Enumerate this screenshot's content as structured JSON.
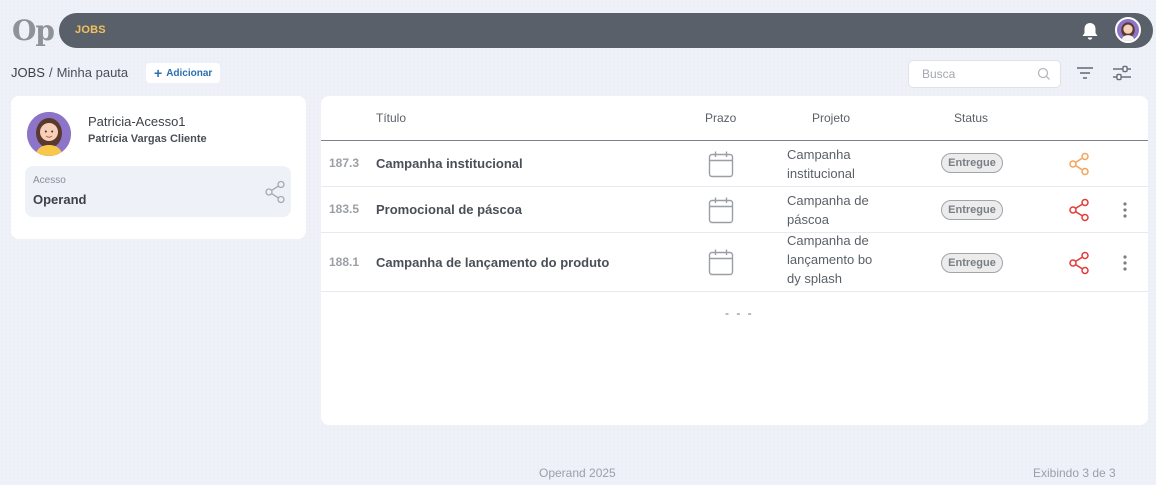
{
  "app": {
    "logo": "Op",
    "section": "JOBS"
  },
  "breadcrumb": {
    "root": "JOBS",
    "separator": "/",
    "current": "Minha pauta"
  },
  "toolbar": {
    "add_label": "Adicionar"
  },
  "search": {
    "placeholder": "Busca",
    "value": ""
  },
  "profile": {
    "name": "Patricia-Acesso1",
    "subtitle": "Patrícia Vargas Cliente",
    "access_label": "Acesso",
    "access_value": "Operand"
  },
  "table": {
    "headers": {
      "title": "Título",
      "deadline": "Prazo",
      "project": "Projeto",
      "status": "Status"
    },
    "rows": [
      {
        "id": "187.3",
        "title": "Campanha institucional",
        "project": "Campanha institucional",
        "status": "Entregue",
        "share_color": "#f5a25d"
      },
      {
        "id": "183.5",
        "title": "Promocional de páscoa",
        "project": "Campanha de páscoa",
        "status": "Entregue",
        "share_color": "#e53935"
      },
      {
        "id": "188.1",
        "title": "Campanha de lançamento do produto",
        "project": "Campanha de lançamento bo dy splash",
        "status": "Entregue",
        "share_color": "#e53935"
      }
    ],
    "pager": "- - -"
  },
  "footer": {
    "copyright": "Operand 2025",
    "count": "Exibindo 3 de 3"
  },
  "colors": {
    "topbar": "#59606a",
    "accent": "#f2c25a",
    "link": "#2b6fb2"
  },
  "icons": [
    "bell-icon",
    "avatar",
    "search-icon",
    "filter-icon",
    "settings-sliders-icon",
    "share-icon",
    "calendar-icon",
    "more-vertical-icon"
  ]
}
